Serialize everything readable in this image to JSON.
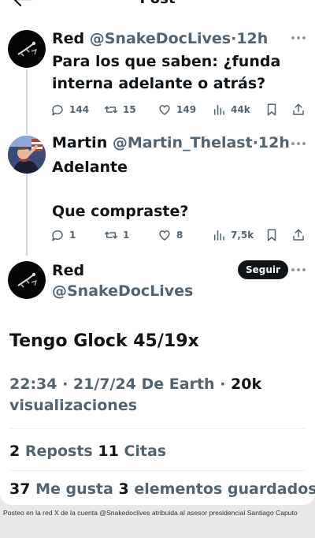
{
  "header": {
    "title": "Post"
  },
  "tweets": [
    {
      "name": "Red",
      "handle": "@SnakeDocLives",
      "dot": "·",
      "time": "12h",
      "line1": "Para los que saben: ¿funda",
      "line2": "interna adelante o atrás?",
      "replies": "144",
      "reposts": "15",
      "likes": "149",
      "views": "44k"
    },
    {
      "name": "Martin",
      "handle": "@Martin_Thelast",
      "dot": "·",
      "time": "12h",
      "line1": "Adelante",
      "line2": "Que compraste?",
      "replies": "1",
      "reposts": "1",
      "likes": "8",
      "views": "7,5k"
    }
  ],
  "main_post": {
    "name": "Red",
    "handle": "@SnakeDocLives",
    "follow_label": "Seguir",
    "text": "Tengo Glock 45/19x",
    "datetime": "22:34 · 21/7/24 De Earth · ",
    "views_count": "20k",
    "views_label": "visualizaciones",
    "reposts_count": "2",
    "reposts_label": "Reposts",
    "quotes_count": "11",
    "quotes_label": "Citas",
    "likes_count": "37",
    "likes_label": "Me gusta",
    "bookmarks_count": "3",
    "bookmarks_label": "elementos guardados"
  },
  "caption": "Posteo en la red X de la cuenta @Snakedoclives atribuida al asesor presidencial Santiago Caputo",
  "colors": {
    "text": "#0f1419",
    "secondary": "#536471",
    "divider": "#eff3f4",
    "thread_line": "#cfd9de",
    "follow_button": "#0f1419",
    "page_background": "#e9e9e9"
  },
  "icons": [
    "back-arrow-icon",
    "more-icon",
    "reply-icon",
    "repost-icon",
    "like-icon",
    "views-icon",
    "bookmark-icon",
    "share-icon"
  ]
}
